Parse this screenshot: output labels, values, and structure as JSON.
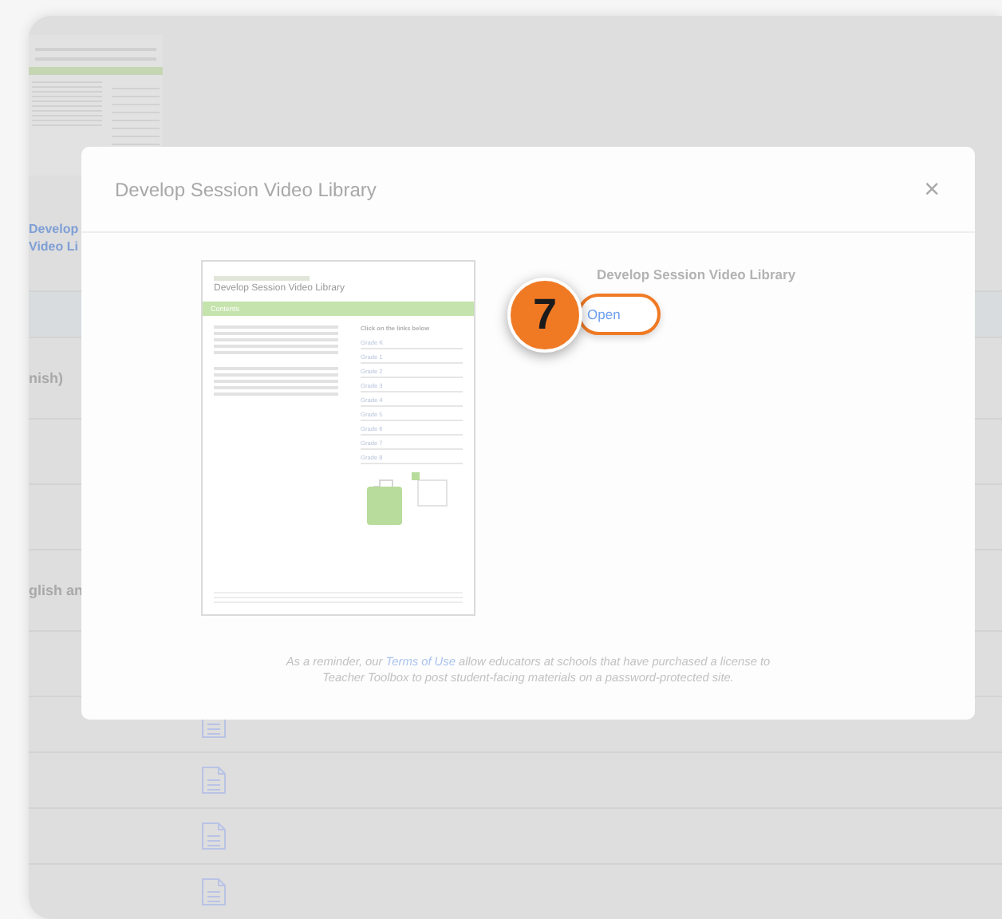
{
  "background_page": {
    "link_lines": [
      "Develop",
      "Video Li"
    ],
    "row_texts": [
      "nish)",
      "glish an"
    ]
  },
  "modal": {
    "title": "Develop Session Video Library",
    "close": "×",
    "document": {
      "title": "Develop Session Video Library",
      "section": "Contents",
      "links_heading": "Click on the links below",
      "links": [
        "Grade K",
        "Grade 1",
        "Grade 2",
        "Grade 3",
        "Grade 4",
        "Grade 5",
        "Grade 6",
        "Grade 7",
        "Grade 8"
      ]
    },
    "item_title": "Develop Session Video Library",
    "open_button": "Open",
    "step_badge": "7",
    "notice": {
      "before": "As a reminder, our",
      "link": "Terms of Use",
      "after": "allow educators at schools that have purchased a license to Teacher Toolbox to post student-facing materials on a password-protected site."
    }
  }
}
